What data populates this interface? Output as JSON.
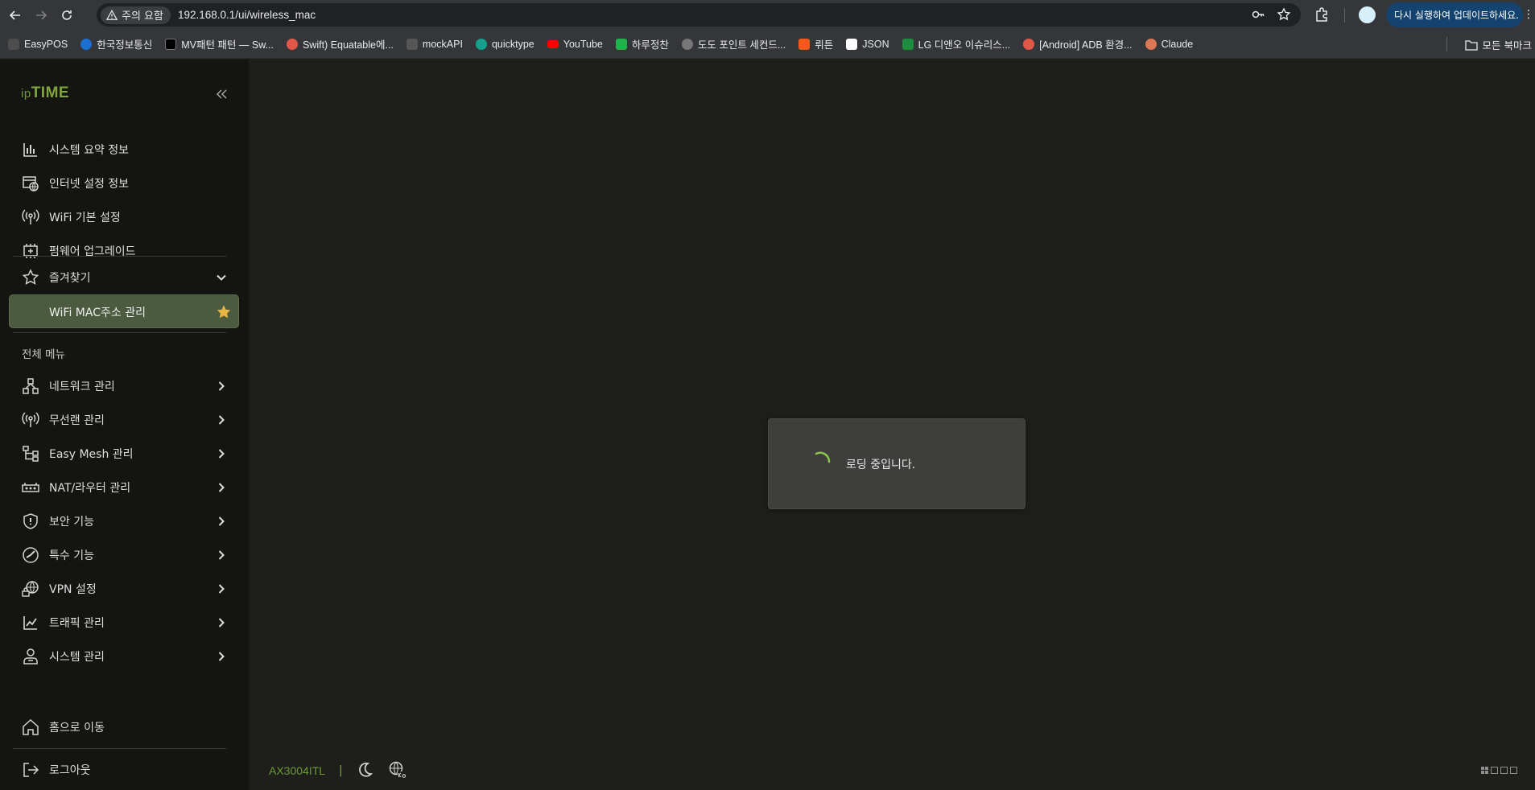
{
  "browser": {
    "warning_chip": "주의 요함",
    "url": "192.168.0.1/ui/wireless_mac",
    "update_button": "다시 실행하여 업데이트하세요.",
    "kebab": "⋮",
    "bookmarks": [
      {
        "label": "EasyPOS",
        "color": "#4d4d4d"
      },
      {
        "label": "한국정보통신",
        "color": "#1a6fd1"
      },
      {
        "label": "MV패턴 패턴 — Sw...",
        "color": "#000000"
      },
      {
        "label": "Swift) Equatable에...",
        "color": "#e25848"
      },
      {
        "label": "mockAPI",
        "color": "#555555"
      },
      {
        "label": "quicktype",
        "color": "#14a08c"
      },
      {
        "label": "YouTube",
        "color": "#ff0000"
      },
      {
        "label": "하루정찬",
        "color": "#22b24c"
      },
      {
        "label": "도도 포인트 세컨드...",
        "color": "#777777"
      },
      {
        "label": "뤼튼",
        "color": "#f35b1e"
      },
      {
        "label": "JSON",
        "color": "#ffffff"
      },
      {
        "label": "LG 디앤오 이슈리스...",
        "color": "#1e8e3e"
      },
      {
        "label": "[Android] ADB 환경...",
        "color": "#e25848"
      },
      {
        "label": "Claude",
        "color": "#d97757"
      }
    ],
    "all_bookmarks": "모든 북마크"
  },
  "app": {
    "logo_prefix": "ip",
    "logo_main": "TIME",
    "menu": {
      "system_summary": "시스템 요약 정보",
      "internet_settings": "인터넷 설정 정보",
      "wifi_basic": "WiFi 기본 설정",
      "firmware_upgrade": "펌웨어 업그레이드",
      "favorites": "즐겨찾기",
      "favorite_active": "WiFi MAC주소 관리",
      "all_menu": "전체 메뉴",
      "network": "네트워크 관리",
      "wireless_lan": "무선랜 관리",
      "easy_mesh": "Easy Mesh 관리",
      "nat_router": "NAT/라우터 관리",
      "security": "보안 기능",
      "special": "특수 기능",
      "vpn": "VPN 설정",
      "traffic": "트래픽 관리",
      "system_mgmt": "시스템 관리",
      "go_home": "홈으로 이동",
      "logout": "로그아웃"
    },
    "model": "AX3004ITL",
    "model_separator": "|",
    "loading_text": "로딩 중입니다.",
    "accent_color": "#7fa63a",
    "star_color": "#e7b642"
  }
}
